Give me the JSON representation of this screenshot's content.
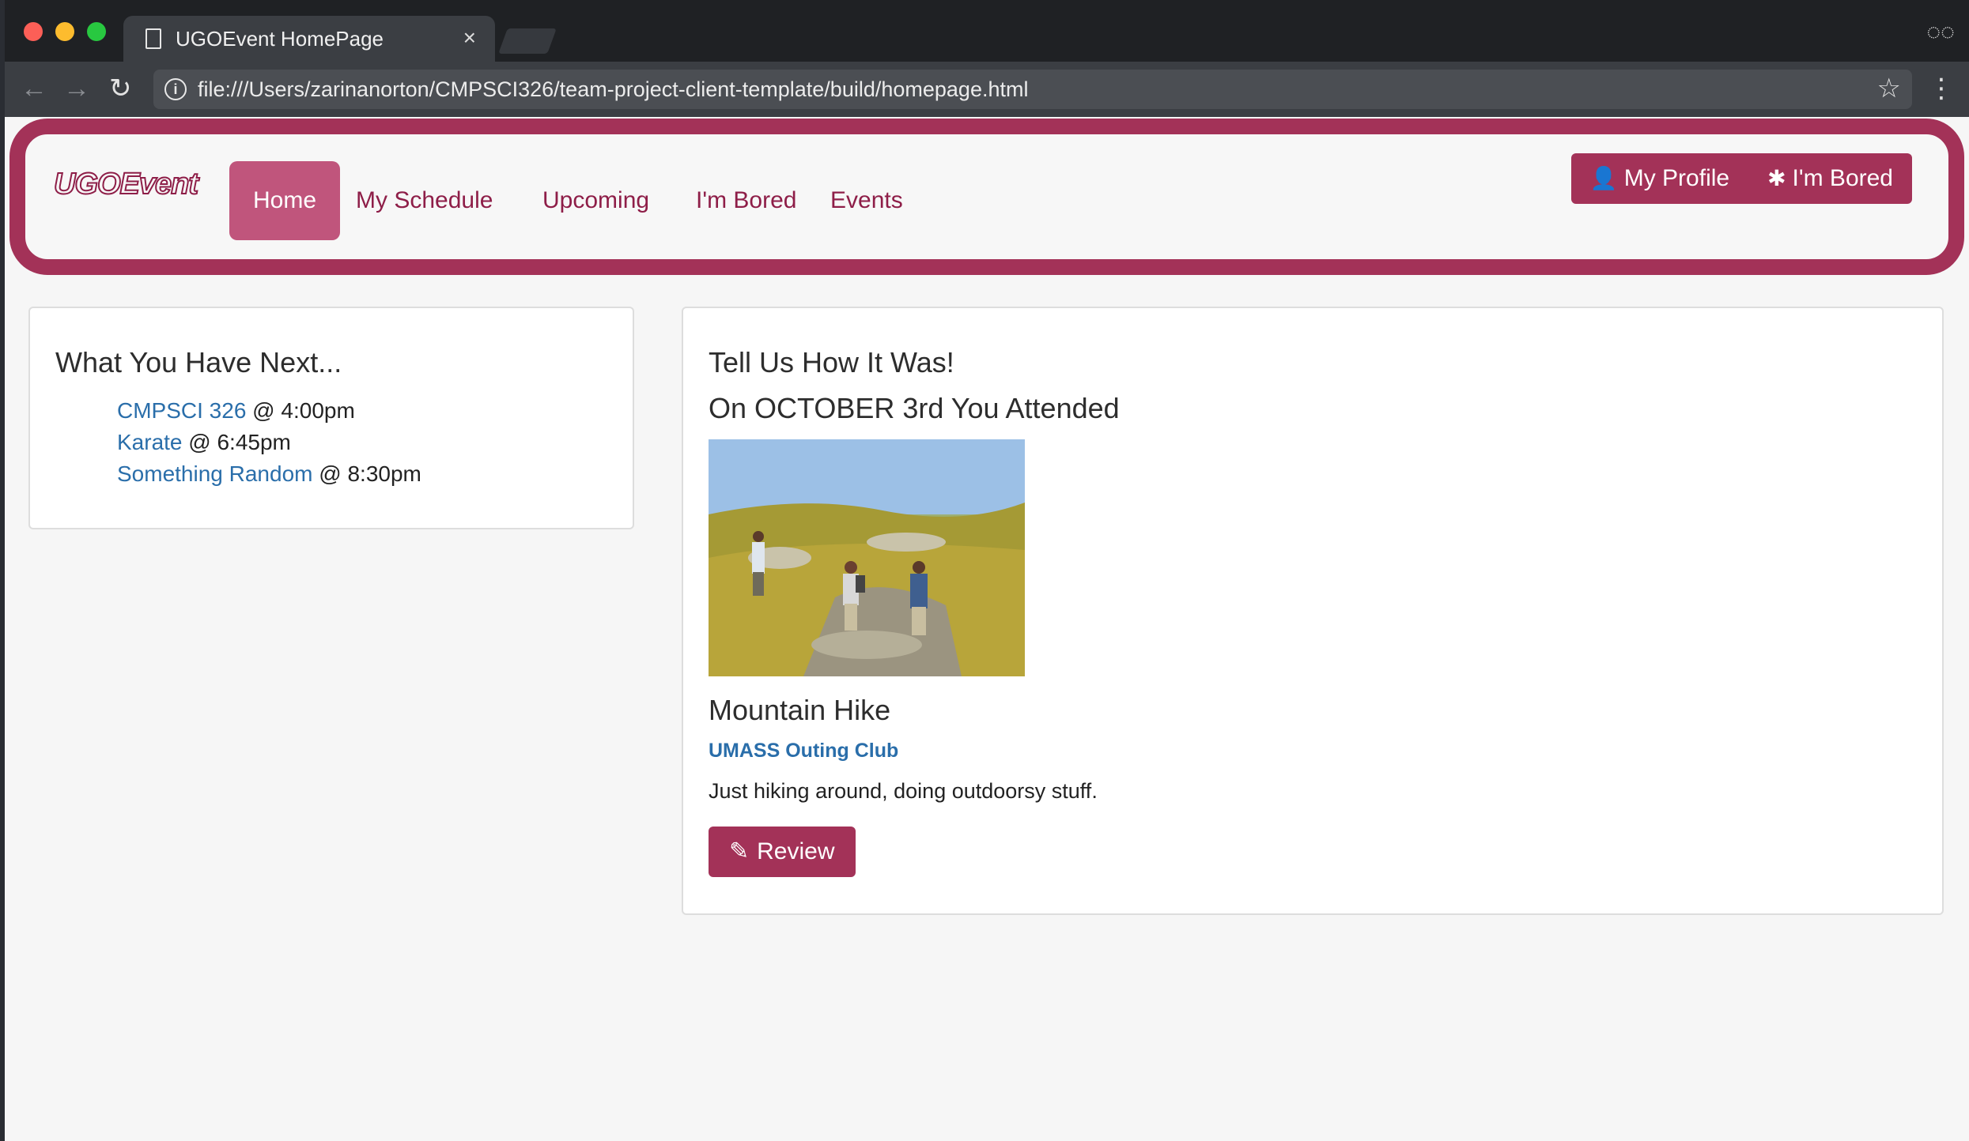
{
  "browser": {
    "tab_title": "UGOEvent HomePage",
    "tab_close": "×",
    "url": "file:///Users/zarinanorton/CMPSCI326/team-project-client-template/build/homepage.html",
    "icons": {
      "back": "←",
      "forward": "→",
      "reload": "↻",
      "info": "i",
      "star": "☆",
      "menu": "⋮",
      "incognito": "◌◌"
    }
  },
  "navbar": {
    "brand": "UGOEvent",
    "links": [
      {
        "label": "Home",
        "active": true
      },
      {
        "label": "My Schedule",
        "active": false
      },
      {
        "label": "Upcoming",
        "active": false
      },
      {
        "label": "I'm Bored",
        "active": false
      },
      {
        "label": "Events",
        "active": false
      }
    ],
    "buttons": {
      "profile": {
        "icon": "👤",
        "label": "My Profile"
      },
      "bored": {
        "icon": "✱",
        "label": "I'm Bored"
      }
    },
    "accent_color": "#a33258",
    "active_color": "#c0557c"
  },
  "next_panel": {
    "title": "What You Have Next...",
    "items": [
      {
        "name": "CMPSCI 326",
        "time": " @ 4:00pm"
      },
      {
        "name": "Karate",
        "time": " @ 6:45pm"
      },
      {
        "name": "Something Random",
        "time": " @ 8:30pm"
      }
    ]
  },
  "review_panel": {
    "title": "Tell Us How It Was!",
    "subtitle": "On OCTOBER 3rd You Attended",
    "event": {
      "name": "Mountain Hike",
      "organizer": "UMASS Outing Club",
      "description": "Just hiking around, doing outdoorsy stuff."
    },
    "button": {
      "icon": "✎",
      "label": "Review"
    }
  }
}
